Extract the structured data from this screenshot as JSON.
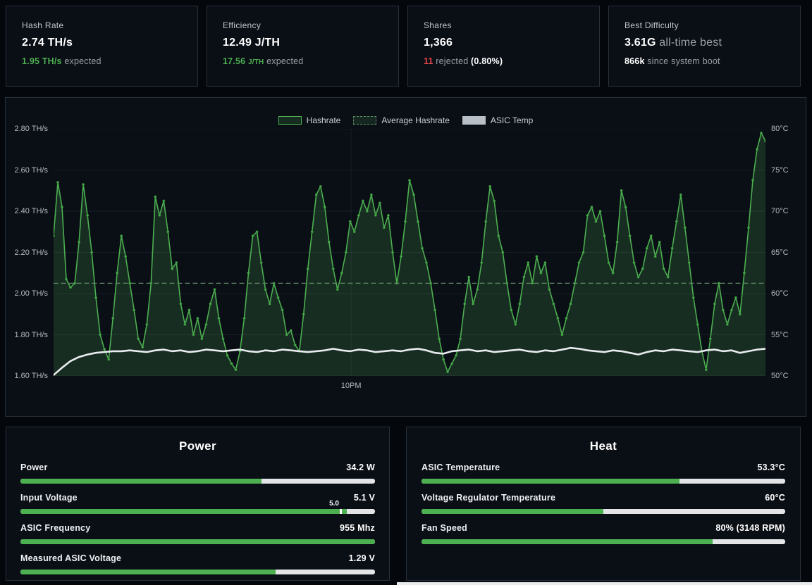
{
  "page": {
    "bg": "#04080d",
    "panel_bg": "#0a0e15",
    "panel_border": "#27303b",
    "accent_green": "#4caf50",
    "reject_red": "#e5484d",
    "bar_trail": "#e2e4e6",
    "muted_text": "#99a0a6",
    "bottom_strip_color": "#e8eaec"
  },
  "cards": [
    {
      "title": "Hash Rate",
      "value_segments": [
        {
          "text": "2.74 TH/s",
          "style": "strong"
        }
      ],
      "sub_segments": [
        {
          "text": "1.95 TH/s",
          "style": "green"
        },
        {
          "text": " expected",
          "style": "muted"
        }
      ]
    },
    {
      "title": "Efficiency",
      "value_segments": [
        {
          "text": "12.49 J/TH",
          "style": "strong"
        }
      ],
      "sub_segments": [
        {
          "text": "17.56 ",
          "style": "green"
        },
        {
          "text": "J/TH",
          "style": "green-small"
        },
        {
          "text": " expected",
          "style": "muted"
        }
      ]
    },
    {
      "title": "Shares",
      "value_segments": [
        {
          "text": "1,366",
          "style": "strong"
        }
      ],
      "sub_segments": [
        {
          "text": "11",
          "style": "red"
        },
        {
          "text": " rejected ",
          "style": "muted"
        },
        {
          "text": "(0.80%)",
          "style": "strong"
        }
      ]
    },
    {
      "title": "Best Difficulty",
      "value_segments": [
        {
          "text": "3.61G",
          "style": "strong"
        },
        {
          "text": " all-time best",
          "style": "muted"
        }
      ],
      "sub_segments": [
        {
          "text": "866k",
          "style": "strong"
        },
        {
          "text": " since system boot",
          "style": "muted"
        }
      ]
    }
  ],
  "chart": {
    "legend": [
      {
        "label": "Hashrate"
      },
      {
        "label": "Average Hashrate"
      },
      {
        "label": "ASIC Temp"
      }
    ],
    "y_left_ticks": [
      "2.80 TH/s",
      "2.60 TH/s",
      "2.40 TH/s",
      "2.20 TH/s",
      "2.00 TH/s",
      "1.80 TH/s",
      "1.60 TH/s"
    ],
    "y_right_ticks": [
      "80°C",
      "75°C",
      "70°C",
      "65°C",
      "60°C",
      "55°C",
      "50°C"
    ],
    "chart_data": {
      "type": "line",
      "title": "",
      "legend_position": "top-center",
      "grid": true,
      "x_tick_labels": [
        {
          "label": "10PM",
          "fraction": 0.418
        }
      ],
      "y_left": {
        "unit": "TH/s",
        "min": 1.6,
        "max": 2.8,
        "tick_step": 0.2
      },
      "y_right": {
        "unit": "°C",
        "min": 50,
        "max": 80,
        "tick_step": 5
      },
      "series": [
        {
          "name": "Hashrate",
          "axis": "left",
          "unit": "TH/s",
          "color": "#4caf50",
          "fill": "rgba(80,170,90,0.20)",
          "style": "area",
          "markers": true,
          "values": [
            2.28,
            2.54,
            2.42,
            2.07,
            2.03,
            2.05,
            2.25,
            2.53,
            2.38,
            2.2,
            1.98,
            1.8,
            1.73,
            1.68,
            1.88,
            2.1,
            2.28,
            2.18,
            2.05,
            1.92,
            1.78,
            1.74,
            1.85,
            2.05,
            2.47,
            2.38,
            2.45,
            2.3,
            2.12,
            2.15,
            1.95,
            1.85,
            1.92,
            1.8,
            1.88,
            1.78,
            1.85,
            1.95,
            2.02,
            1.88,
            1.78,
            1.7,
            1.66,
            1.63,
            1.72,
            1.88,
            2.1,
            2.28,
            2.3,
            2.15,
            2.02,
            1.95,
            2.05,
            1.98,
            1.92,
            1.8,
            1.82,
            1.75,
            1.72,
            1.9,
            2.12,
            2.3,
            2.48,
            2.52,
            2.42,
            2.25,
            2.12,
            2.02,
            2.1,
            2.2,
            2.35,
            2.3,
            2.38,
            2.45,
            2.4,
            2.48,
            2.38,
            2.44,
            2.32,
            2.38,
            2.2,
            2.05,
            2.18,
            2.35,
            2.55,
            2.48,
            2.35,
            2.22,
            2.15,
            2.05,
            1.92,
            1.78,
            1.68,
            1.62,
            1.66,
            1.7,
            1.78,
            1.95,
            2.08,
            1.95,
            2.02,
            2.15,
            2.35,
            2.52,
            2.45,
            2.28,
            2.2,
            2.05,
            1.92,
            1.85,
            1.95,
            2.08,
            2.15,
            2.05,
            2.18,
            2.1,
            2.15,
            2.02,
            1.95,
            1.88,
            1.8,
            1.88,
            1.95,
            2.05,
            2.15,
            2.2,
            2.38,
            2.42,
            2.35,
            2.4,
            2.28,
            2.15,
            2.1,
            2.25,
            2.5,
            2.42,
            2.28,
            2.15,
            2.08,
            2.12,
            2.22,
            2.28,
            2.18,
            2.25,
            2.12,
            2.08,
            2.22,
            2.35,
            2.48,
            2.32,
            2.15,
            1.98,
            1.85,
            1.72,
            1.63,
            1.78,
            1.95,
            2.05,
            1.92,
            1.85,
            1.92,
            1.98,
            1.9,
            2.1,
            2.32,
            2.55,
            2.7,
            2.78,
            2.74
          ]
        },
        {
          "name": "Average Hashrate",
          "axis": "left",
          "unit": "TH/s",
          "color": "#5c8a63",
          "fill": "rgba(60,110,70,0.25)",
          "style": "dashed",
          "markers": false,
          "values": [
            2.05,
            2.05
          ]
        },
        {
          "name": "ASIC Temp",
          "axis": "right",
          "unit": "°C",
          "color": "#e8ecef",
          "fill": "#b9bfc6",
          "style": "line",
          "markers": false,
          "values": [
            50.1,
            51.0,
            51.8,
            52.3,
            52.6,
            52.8,
            52.9,
            53.0,
            53.0,
            53.1,
            53.0,
            52.9,
            53.1,
            53.2,
            53.0,
            53.1,
            52.9,
            53.0,
            53.2,
            53.1,
            53.0,
            53.1,
            53.2,
            53.0,
            52.9,
            53.1,
            53.0,
            53.2,
            53.1,
            53.0,
            52.9,
            53.0,
            53.1,
            53.3,
            53.1,
            53.0,
            53.2,
            53.1,
            52.9,
            53.0,
            53.1,
            53.0,
            53.2,
            53.3,
            53.1,
            52.8,
            52.7,
            53.0,
            53.1,
            53.2,
            53.0,
            53.1,
            52.9,
            53.0,
            53.1,
            53.2,
            53.0,
            52.9,
            53.1,
            53.0,
            53.2,
            53.4,
            53.3,
            53.1,
            53.0,
            52.9,
            53.1,
            53.0,
            52.8,
            52.6,
            52.9,
            53.1,
            53.0,
            53.2,
            53.1,
            53.0,
            52.9,
            53.1,
            53.2,
            53.0,
            53.1,
            52.8,
            53.0,
            53.2,
            53.3
          ]
        }
      ]
    }
  },
  "power_panel": {
    "title": "Power",
    "rows": [
      {
        "label": "Power",
        "value": "34.2 W",
        "fraction": 0.68
      },
      {
        "label": "Input Voltage",
        "value": "5.1 V",
        "fraction": 0.92,
        "marker": {
          "label": "5.0",
          "pos": 0.9
        }
      },
      {
        "label": "ASIC Frequency",
        "value": "955 Mhz",
        "fraction": 1.0
      },
      {
        "label": "Measured ASIC Voltage",
        "value": "1.29 V",
        "fraction": 0.72
      }
    ]
  },
  "heat_panel": {
    "title": "Heat",
    "rows": [
      {
        "label": "ASIC Temperature",
        "value": "53.3°C",
        "fraction": 0.71
      },
      {
        "label": "Voltage Regulator Temperature",
        "value": "60°C",
        "fraction": 0.5
      },
      {
        "label": "Fan Speed",
        "value": "80% (3148 RPM)",
        "fraction": 0.8
      }
    ]
  }
}
